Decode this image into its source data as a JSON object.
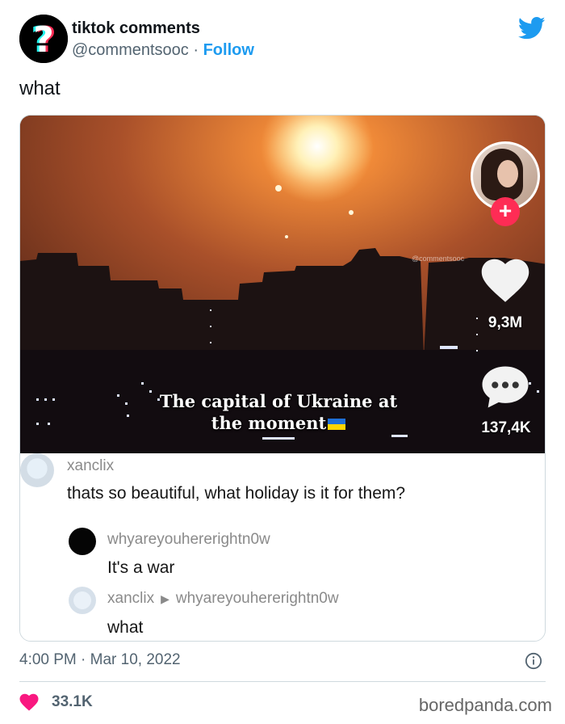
{
  "tweet": {
    "author_name": "tiktok comments",
    "handle": "@commentsooc",
    "separator": "·",
    "follow_label": "Follow",
    "text": "what",
    "timestamp": "4:00 PM · Mar 10, 2022",
    "likes": "33.1K",
    "source": "boredpanda.com"
  },
  "video": {
    "caption_line1": "The capital of Ukraine at",
    "caption_line2": "the moment",
    "watermark": "@commentsooc",
    "like_count": "9,3M",
    "comment_count": "137,4K",
    "follow_plus": "+"
  },
  "comments": [
    {
      "user": "xanclix",
      "text": "thats so beautiful, what holiday is it for them?"
    },
    {
      "user": "whyareyouhererightn0w",
      "text": "It's a war"
    },
    {
      "user": "xanclix",
      "reply_to": "whyareyouhererightn0w",
      "arrow": "▶",
      "text": "what"
    }
  ],
  "colors": {
    "twitter_blue": "#1d9bf0",
    "like_red": "#f91880",
    "tiktok_red": "#fe2c55"
  },
  "icons": [
    "question-mark-avatar-icon",
    "twitter-bird-icon",
    "heart-icon",
    "comment-bubble-icon",
    "info-icon"
  ]
}
